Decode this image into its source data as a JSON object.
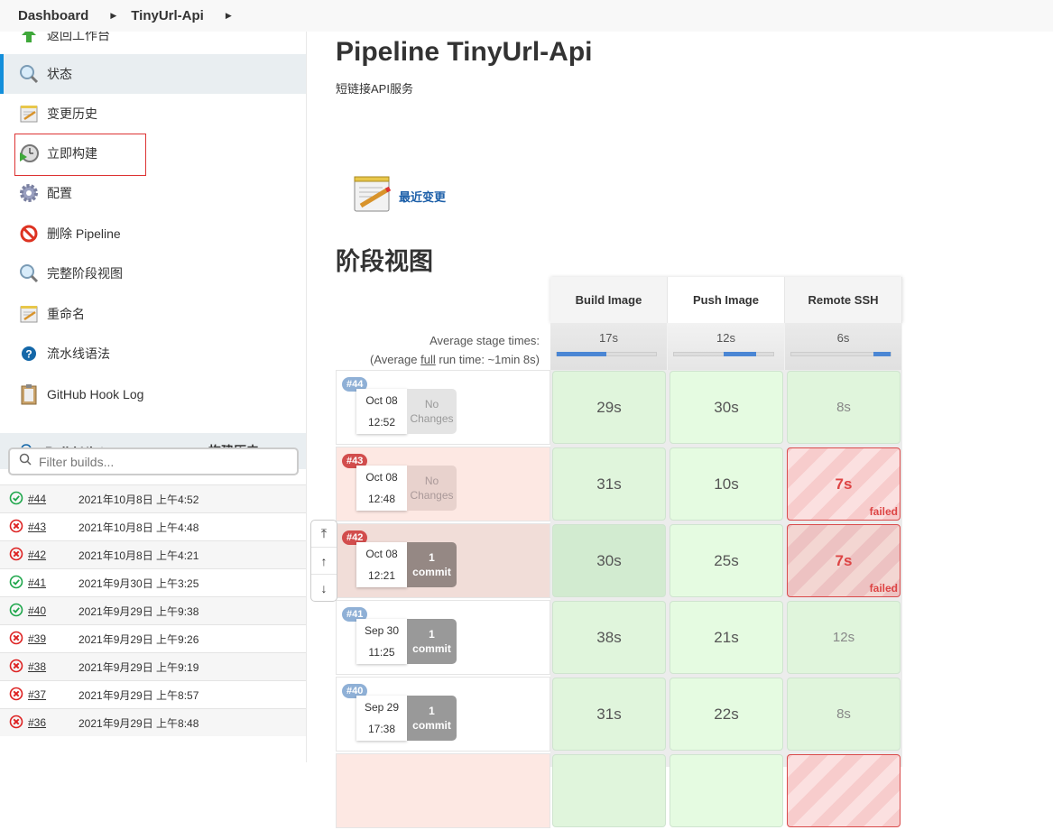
{
  "breadcrumb": {
    "items": [
      "Dashboard",
      "TinyUrl-Api"
    ]
  },
  "sidebar": {
    "tasks": [
      {
        "label": "返回工作台",
        "icon": "up-arrow-icon"
      },
      {
        "label": "状态",
        "icon": "search-icon",
        "active": true
      },
      {
        "label": "变更历史",
        "icon": "notepad-icon"
      },
      {
        "label": "立即构建",
        "icon": "build-now-clock-icon",
        "highlighted": true
      },
      {
        "label": "配置",
        "icon": "gear-icon"
      },
      {
        "label": "删除 Pipeline",
        "icon": "no-entry-icon"
      },
      {
        "label": "完整阶段视图",
        "icon": "search-icon"
      },
      {
        "label": "重命名",
        "icon": "notepad-icon"
      },
      {
        "label": "流水线语法",
        "icon": "help-icon"
      },
      {
        "label": "GitHub Hook Log",
        "icon": "clipboard-icon"
      }
    ]
  },
  "build_history": {
    "title": "Build History",
    "trend_link": "构建历史",
    "filter_placeholder": "Filter builds...",
    "builds": [
      {
        "number": "#44",
        "status": "success",
        "date": "2021年10月8日 上午4:52"
      },
      {
        "number": "#43",
        "status": "failed",
        "date": "2021年10月8日 上午4:48"
      },
      {
        "number": "#42",
        "status": "failed",
        "date": "2021年10月8日 上午4:21"
      },
      {
        "number": "#41",
        "status": "success",
        "date": "2021年9月30日 上午3:25"
      },
      {
        "number": "#40",
        "status": "success",
        "date": "2021年9月29日 上午9:38"
      },
      {
        "number": "#39",
        "status": "failed",
        "date": "2021年9月29日 上午9:26"
      },
      {
        "number": "#38",
        "status": "failed",
        "date": "2021年9月29日 上午9:19"
      },
      {
        "number": "#37",
        "status": "failed",
        "date": "2021年9月29日 上午8:57"
      },
      {
        "number": "#36",
        "status": "failed",
        "date": "2021年9月29日 上午8:48"
      }
    ]
  },
  "main": {
    "title": "Pipeline TinyUrl-Api",
    "description": "短链接API服务",
    "recent_changes": "最近变更",
    "stage_view_title": "阶段视图"
  },
  "stage_view": {
    "stages": [
      "Build Image",
      "Push Image",
      "Remote SSH"
    ],
    "avg_label_line1": "Average stage times:",
    "avg_label_pre": "(Average ",
    "avg_label_full": "full",
    "avg_label_post": " run time: ~1min 8s)",
    "avg_times": [
      "17s",
      "12s",
      "6s"
    ],
    "avg_bar_segments": [
      {
        "start": 0,
        "end": 0.5
      },
      {
        "start": 0.5,
        "end": 0.83
      },
      {
        "start": 0.83,
        "end": 1.0
      }
    ],
    "runs": [
      {
        "number": "#44",
        "status": "success",
        "date": "Oct 08",
        "time": "12:52",
        "changes_line1": "No",
        "changes_line2": "Changes",
        "has_commits": false,
        "stages": [
          {
            "time": "29s",
            "status": "success"
          },
          {
            "time": "30s",
            "status": "success"
          },
          {
            "time": "8s",
            "status": "success"
          }
        ]
      },
      {
        "number": "#43",
        "status": "failed",
        "date": "Oct 08",
        "time": "12:48",
        "changes_line1": "No",
        "changes_line2": "Changes",
        "has_commits": false,
        "stages": [
          {
            "time": "31s",
            "status": "success"
          },
          {
            "time": "10s",
            "status": "success"
          },
          {
            "time": "7s",
            "status": "failed",
            "label": "failed"
          }
        ]
      },
      {
        "number": "#42",
        "status": "failed",
        "date": "Oct 08",
        "time": "12:21",
        "changes_line1": "1",
        "changes_line2": "commit",
        "has_commits": true,
        "stages": [
          {
            "time": "30s",
            "status": "success"
          },
          {
            "time": "25s",
            "status": "success"
          },
          {
            "time": "7s",
            "status": "failed",
            "label": "failed"
          }
        ]
      },
      {
        "number": "#41",
        "status": "success",
        "date": "Sep 30",
        "time": "11:25",
        "changes_line1": "1",
        "changes_line2": "commit",
        "has_commits": true,
        "stages": [
          {
            "time": "38s",
            "status": "success"
          },
          {
            "time": "21s",
            "status": "success"
          },
          {
            "time": "12s",
            "status": "success"
          }
        ]
      },
      {
        "number": "#40",
        "status": "success",
        "date": "Sep 29",
        "time": "17:38",
        "changes_line1": "1",
        "changes_line2": "commit",
        "has_commits": true,
        "stages": [
          {
            "time": "31s",
            "status": "success"
          },
          {
            "time": "22s",
            "status": "success"
          },
          {
            "time": "8s",
            "status": "success"
          }
        ]
      }
    ]
  },
  "scroll_controls": [
    "⤒",
    "↑",
    "↓"
  ],
  "colors": {
    "accent": "#138fdb",
    "success": "#1ea64b",
    "failure": "#d24d4d",
    "link": "#1b5ea8"
  }
}
